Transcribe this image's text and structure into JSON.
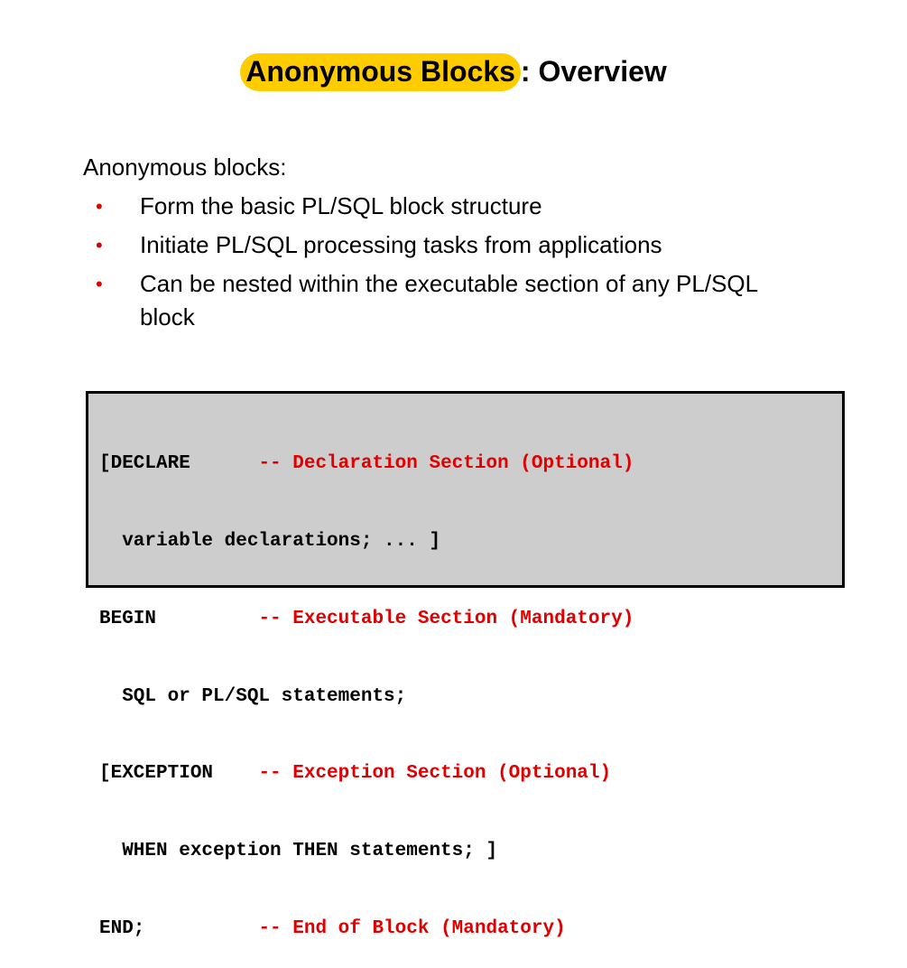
{
  "slide": {
    "title_highlight": "Anonymous Blocks",
    "title_rest": ": Overview",
    "intro": "Anonymous blocks:",
    "bullets": [
      "Form the basic PL/SQL block structure",
      "Initiate PL/SQL processing tasks from applications",
      "Can be nested within the executable section of any PL/SQL block"
    ],
    "bullet_symbol": "•",
    "accent_color": "#ffcc00",
    "bullet_color": "#e00000"
  },
  "code": {
    "lines": [
      {
        "code": "[DECLARE      ",
        "comment": "-- Declaration Section (Optional)"
      },
      {
        "code": "  variable declarations; ... ]",
        "comment": ""
      },
      {
        "code": "BEGIN         ",
        "comment": "-- Executable Section (Mandatory)"
      },
      {
        "code": "  SQL or PL/SQL statements;",
        "comment": ""
      },
      {
        "code": "[EXCEPTION    ",
        "comment": "-- Exception Section (Optional)"
      },
      {
        "code": "  WHEN exception THEN statements; ]",
        "comment": ""
      },
      {
        "code": "END;          ",
        "comment": "-- End of Block (Mandatory)"
      }
    ],
    "background": "#cdcdcd",
    "comment_color": "#e00000"
  }
}
